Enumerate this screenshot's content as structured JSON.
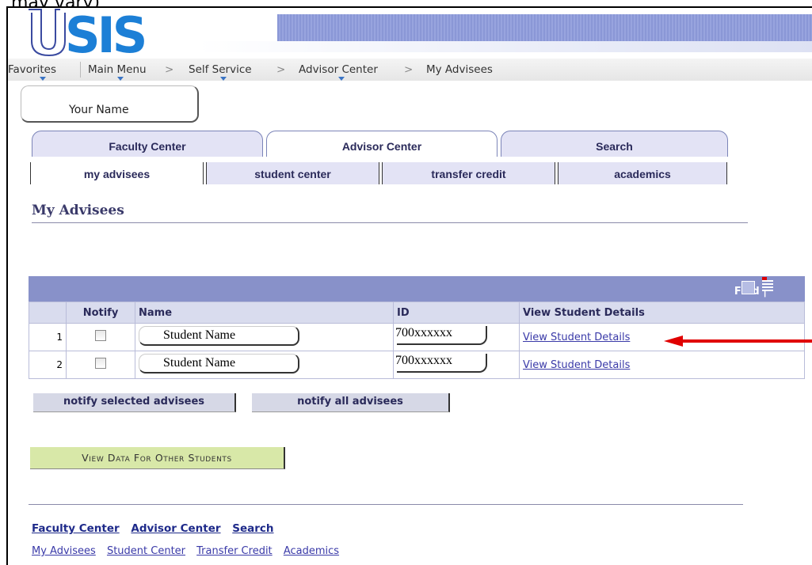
{
  "top_cut_text": "may vary)",
  "logo_text": "SIS",
  "breadcrumb": {
    "favorites": "Favorites",
    "main_menu": "Main Menu",
    "self_service": "Self Service",
    "advisor_center": "Advisor Center",
    "current": "My Advisees",
    "separator": ">"
  },
  "user_name": "Your Name",
  "main_tabs": [
    {
      "label": "Faculty Center"
    },
    {
      "label": "Advisor Center"
    },
    {
      "label": "Search"
    }
  ],
  "sub_tabs": [
    {
      "label": "my advisees"
    },
    {
      "label": "student center"
    },
    {
      "label": "transfer credit"
    },
    {
      "label": "academics"
    }
  ],
  "page_title": "My Advisees",
  "grid": {
    "find_label": "Find",
    "columns": [
      "Notify",
      "Name",
      "ID",
      "View Student Details"
    ],
    "rows": [
      {
        "num": "1",
        "name": "Student Name",
        "id": "700xxxxxx",
        "link": "View Student Details"
      },
      {
        "num": "2",
        "name": "Student Name",
        "id": "700xxxxxx",
        "link": "View Student Details"
      }
    ]
  },
  "buttons": {
    "notify_selected": "notify selected advisees",
    "notify_all": "notify all advisees",
    "view_other": "View Data For Other Students"
  },
  "footer": {
    "main_links": [
      "Faculty Center",
      "Advisor Center",
      "Search"
    ],
    "sub_links": [
      "My Advisees",
      "Student Center",
      "Transfer Credit",
      "Academics"
    ]
  },
  "colors": {
    "grid_header": "#8891c9",
    "tab_bg": "#e3e3f5",
    "link": "#3a3aa8",
    "green_button": "#d8e8a8",
    "arrow": "#e00000"
  }
}
